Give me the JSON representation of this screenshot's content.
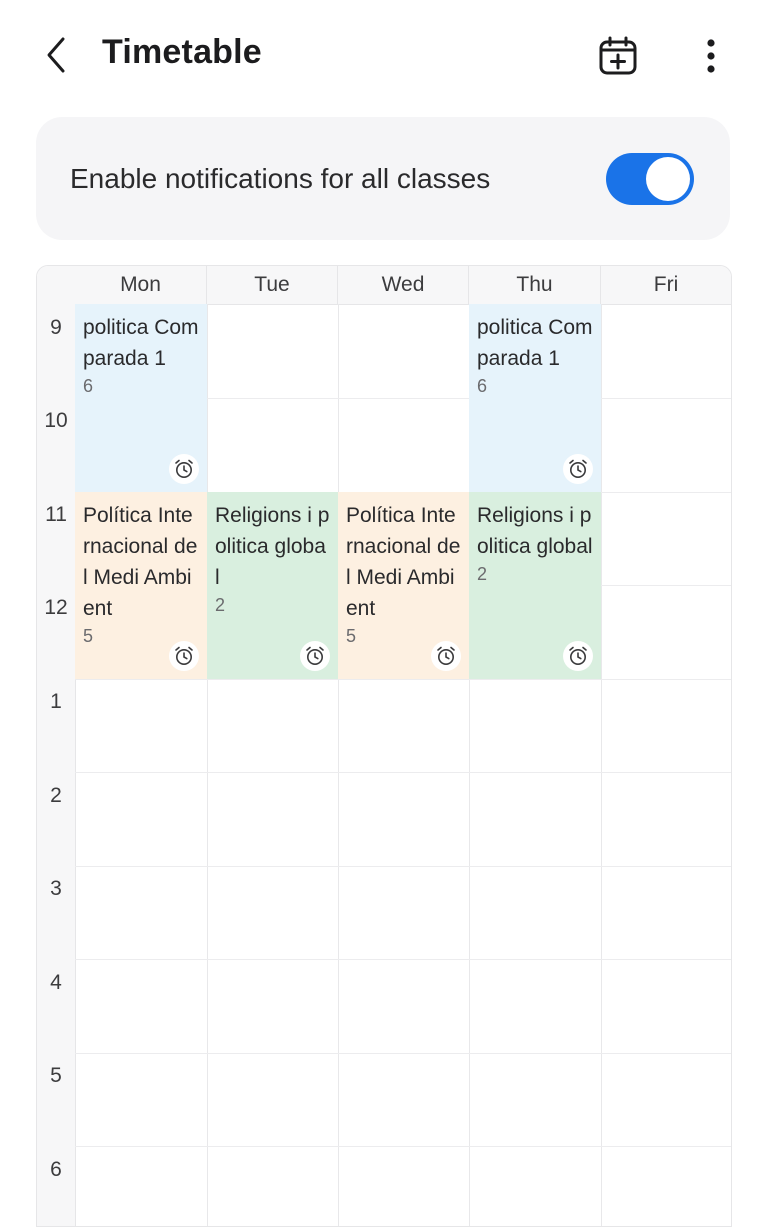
{
  "header": {
    "title": "Timetable"
  },
  "icons": {
    "back": "chevron-left-icon",
    "add_calendar": "calendar-add-icon",
    "more": "more-vertical-icon",
    "alarm": "alarm-icon"
  },
  "notifications": {
    "label": "Enable notifications for all classes",
    "enabled": true
  },
  "colors": {
    "accent": "#1a73e8",
    "blue_block": "#e6f3fb",
    "orange_block": "#fdf0e1",
    "green_block": "#d9efdf"
  },
  "days": [
    "Mon",
    "Tue",
    "Wed",
    "Thu",
    "Fri"
  ],
  "hours": [
    "9",
    "10",
    "11",
    "12",
    "1",
    "2",
    "3",
    "4",
    "5",
    "6"
  ],
  "classes": [
    {
      "name": "politica Comparada 1",
      "room": "6"
    },
    {
      "name": "politica Comparada 1",
      "room": "6"
    },
    {
      "name": "Política Internacional del Medi Ambient",
      "room": "5"
    },
    {
      "name": "Religions i politica global",
      "room": "2"
    },
    {
      "name": "Política Internacional del Medi Ambient",
      "room": "5"
    },
    {
      "name": "Religions i politica global",
      "room": "2"
    }
  ]
}
